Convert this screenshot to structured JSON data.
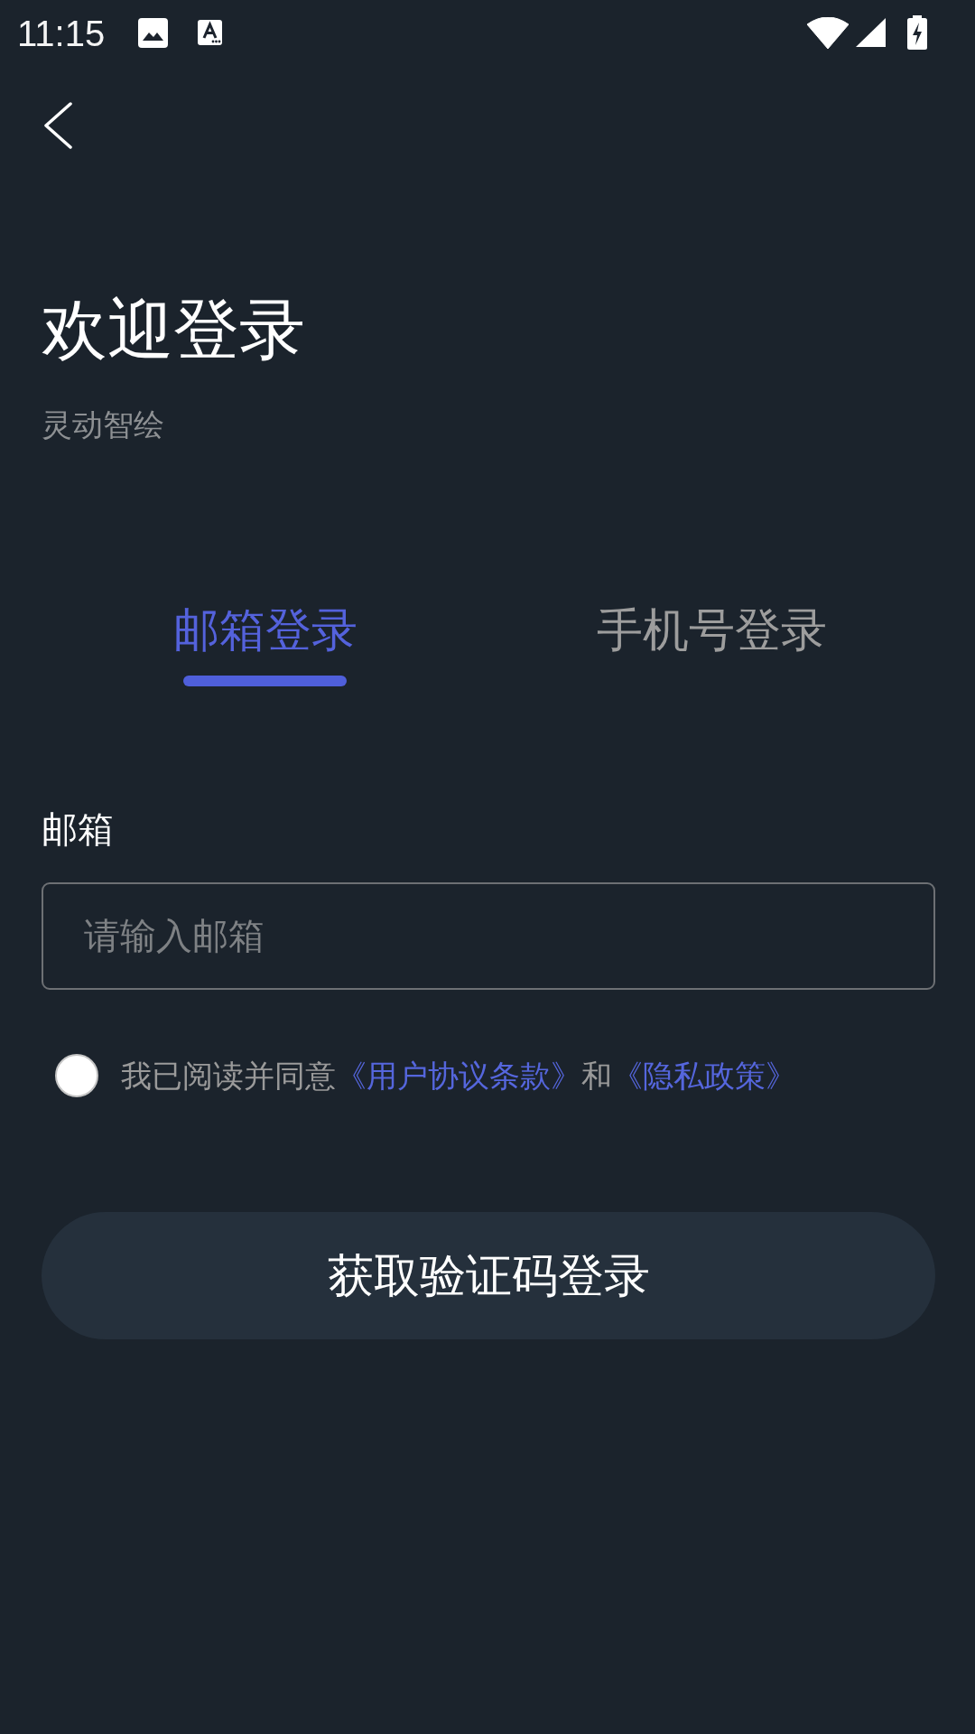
{
  "status_bar": {
    "time": "11:15"
  },
  "header": {
    "title": "欢迎登录",
    "subtitle": "灵动智绘"
  },
  "tabs": [
    {
      "label": "邮箱登录",
      "selected": true
    },
    {
      "label": "手机号登录",
      "selected": false
    }
  ],
  "form": {
    "label": "邮箱",
    "email_field": {
      "placeholder": "请输入邮箱"
    }
  },
  "agreement": {
    "checked": false,
    "parts": [
      {
        "kind": "text",
        "text": "我已阅读并同意"
      },
      {
        "kind": "link",
        "text": "《用户协议条款》"
      },
      {
        "kind": "text",
        "text": "和"
      },
      {
        "kind": "link",
        "text": "《隐私政策》"
      }
    ]
  },
  "submit_button": {
    "label": "获取验证码登录"
  }
}
